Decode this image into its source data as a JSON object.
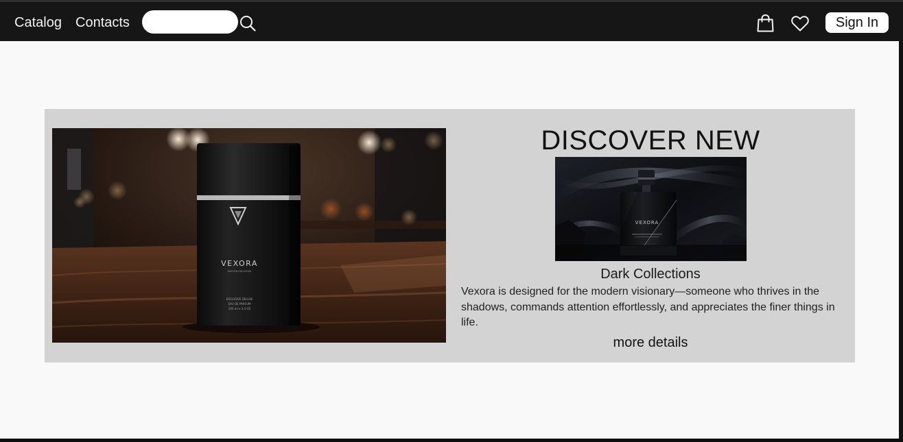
{
  "nav": {
    "links": [
      {
        "label": "Catalog"
      },
      {
        "label": "Contacts"
      }
    ],
    "search": {
      "value": "",
      "placeholder": ""
    },
    "icons": [
      "search-icon",
      "shopping-bag-icon",
      "heart-icon"
    ],
    "sign_in_label": "Sign In"
  },
  "promo": {
    "title": "DISCOVER NEW",
    "collection_name": "Dark Collections",
    "description": "Vexora is designed for the modern visionary—someone who thrives in the shadows, commands attention effortlessly, and appreciates the finer things in life.",
    "more_details_label": "more details",
    "hero_bottle": {
      "brand": "VEXORA",
      "subtitle": "EDITION EXCLUSIVE",
      "line1": "EXCLUSIVE DELUXE",
      "line2": "EAU DE PARFUM",
      "volume": "100 ml e 3.4 OZ"
    },
    "product_bottle": {
      "brand": "VEXORA"
    }
  },
  "colors": {
    "navbar": "#161616",
    "page_background": "#f9f9f9",
    "banner_background": "#d3d3d3",
    "text": "#121212"
  }
}
